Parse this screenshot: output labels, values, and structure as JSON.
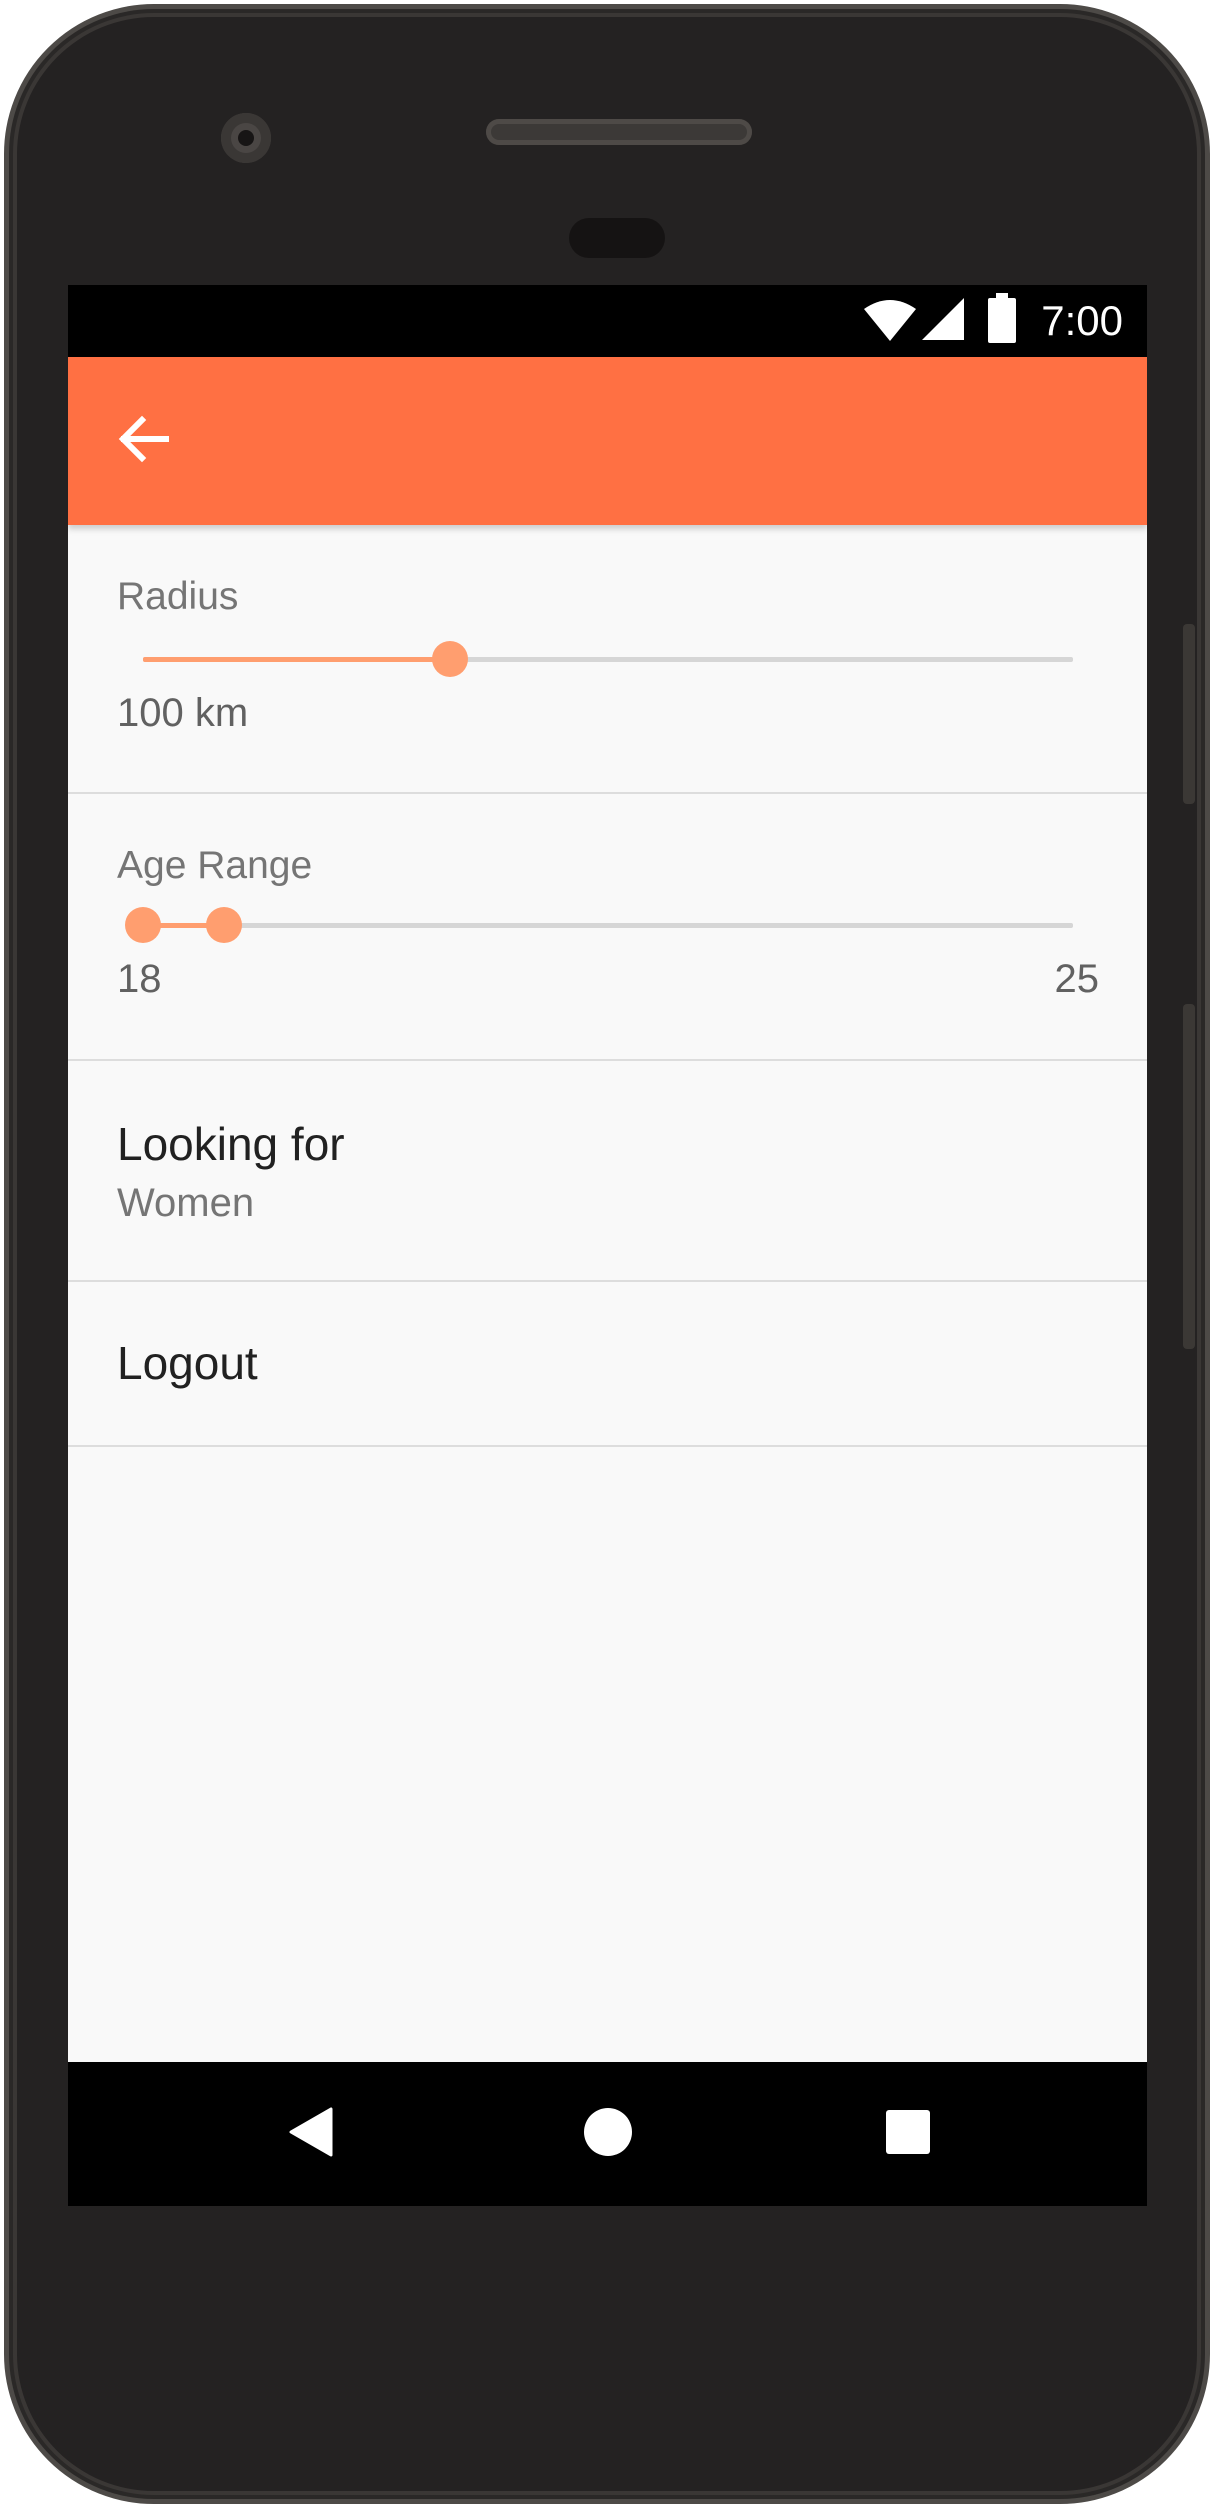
{
  "status_bar": {
    "time": "7:00"
  },
  "app_bar": {
    "back_icon": "arrow-back-icon",
    "color": "#ff7043"
  },
  "radius": {
    "label": "Radius",
    "value_text": "100 km",
    "value_fraction": 0.33
  },
  "age_range": {
    "label": "Age Range",
    "min_text": "18",
    "max_text": "25",
    "low_fraction": 0.0,
    "high_fraction": 0.087
  },
  "looking_for": {
    "label": "Looking for",
    "value": "Women"
  },
  "logout": {
    "label": "Logout"
  },
  "nav_bar": {
    "back_icon": "triangle-back-icon",
    "home_icon": "circle-home-icon",
    "recents_icon": "square-recents-icon"
  },
  "colors": {
    "accent": "#ff9e6f",
    "track": "#d6d6d6"
  }
}
